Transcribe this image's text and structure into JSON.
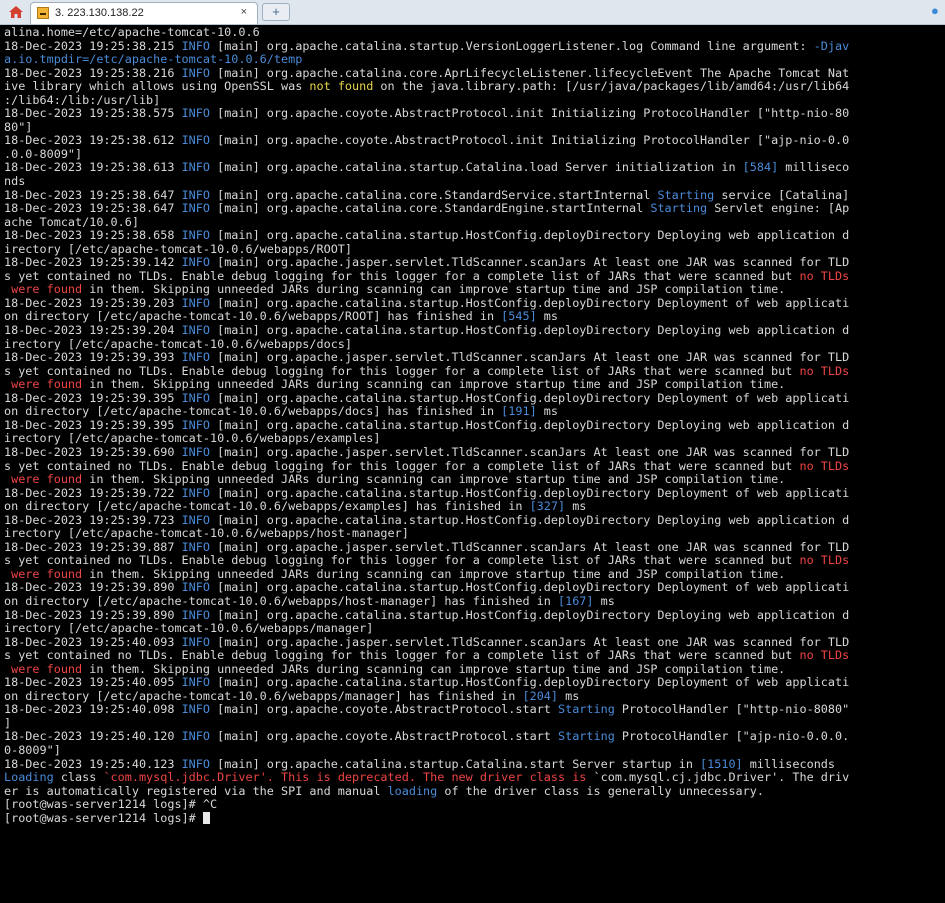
{
  "tab": {
    "title": "3. 223.130.138.22",
    "close": "×",
    "new_tab": "+"
  },
  "icons": {
    "home": "home-icon",
    "tab": "terminal-icon",
    "corner": "info-icon"
  },
  "colors": {
    "info": "#4a8bd8",
    "error": "#ef4444",
    "warning": "#e6d34a"
  },
  "terminal_lines": [
    [
      {
        "t": "alina.home=/etc/apache-tomcat-10.0.6"
      }
    ],
    [
      {
        "t": "18-Dec-2023 19:25:38.215 "
      },
      {
        "t": "INFO",
        "c": "info"
      },
      {
        "t": " [main] org.apache.catalina.startup.VersionLoggerListener.log Command line argument: "
      },
      {
        "t": "-Djav",
        "c": "info"
      }
    ],
    [
      {
        "t": "a.io.tmpdir=/etc/apache-tomcat-10.0.6/temp",
        "c": "info"
      }
    ],
    [
      {
        "t": "18-Dec-2023 19:25:38.216 "
      },
      {
        "t": "INFO",
        "c": "info"
      },
      {
        "t": " [main] org.apache.catalina.core.AprLifecycleListener.lifecycleEvent The Apache Tomcat Nat"
      }
    ],
    [
      {
        "t": "ive library which allows using OpenSSL was "
      },
      {
        "t": "not found",
        "c": "yellow"
      },
      {
        "t": " on the java.library.path: [/usr/java/packages/lib/amd64:/usr/lib64"
      }
    ],
    [
      {
        "t": ":/lib64:/lib:/usr/lib]"
      }
    ],
    [
      {
        "t": "18-Dec-2023 19:25:38.575 "
      },
      {
        "t": "INFO",
        "c": "info"
      },
      {
        "t": " [main] org.apache.coyote.AbstractProtocol.init Initializing ProtocolHandler [\"http-nio-80"
      }
    ],
    [
      {
        "t": "80\"]"
      }
    ],
    [
      {
        "t": "18-Dec-2023 19:25:38.612 "
      },
      {
        "t": "INFO",
        "c": "info"
      },
      {
        "t": " [main] org.apache.coyote.AbstractProtocol.init Initializing ProtocolHandler [\"ajp-nio-0.0"
      }
    ],
    [
      {
        "t": ".0.0-8009\"]"
      }
    ],
    [
      {
        "t": "18-Dec-2023 19:25:38.613 "
      },
      {
        "t": "INFO",
        "c": "info"
      },
      {
        "t": " [main] org.apache.catalina.startup.Catalina.load Server initialization in "
      },
      {
        "t": "[584]",
        "c": "num"
      },
      {
        "t": " milliseco"
      }
    ],
    [
      {
        "t": "nds"
      }
    ],
    [
      {
        "t": "18-Dec-2023 19:25:38.647 "
      },
      {
        "t": "INFO",
        "c": "info"
      },
      {
        "t": " [main] org.apache.catalina.core.StandardService.startInternal "
      },
      {
        "t": "Starting",
        "c": "starting"
      },
      {
        "t": " service [Catalina]"
      }
    ],
    [
      {
        "t": "18-Dec-2023 19:25:38.647 "
      },
      {
        "t": "INFO",
        "c": "info"
      },
      {
        "t": " [main] org.apache.catalina.core.StandardEngine.startInternal "
      },
      {
        "t": "Starting",
        "c": "starting"
      },
      {
        "t": " Servlet engine: [Ap"
      }
    ],
    [
      {
        "t": "ache Tomcat/10.0.6]"
      }
    ],
    [
      {
        "t": "18-Dec-2023 19:25:38.658 "
      },
      {
        "t": "INFO",
        "c": "info"
      },
      {
        "t": " [main] org.apache.catalina.startup.HostConfig.deployDirectory Deploying web application d"
      }
    ],
    [
      {
        "t": "irectory [/etc/apache-tomcat-10.0.6/webapps/ROOT]"
      }
    ],
    [
      {
        "t": "18-Dec-2023 19:25:39.142 "
      },
      {
        "t": "INFO",
        "c": "info"
      },
      {
        "t": " [main] org.apache.jasper.servlet.TldScanner.scanJars At least one JAR was scanned for TLD"
      }
    ],
    [
      {
        "t": "s yet contained no TLDs. Enable debug logging for this logger for a complete list of JARs that were scanned but "
      },
      {
        "t": "no TLDs",
        "c": "warn"
      }
    ],
    [
      {
        "t": " were found",
        "c": "warn"
      },
      {
        "t": " in them. Skipping unneeded JARs during scanning can improve startup time and JSP compilation time."
      }
    ],
    [
      {
        "t": "18-Dec-2023 19:25:39.203 "
      },
      {
        "t": "INFO",
        "c": "info"
      },
      {
        "t": " [main] org.apache.catalina.startup.HostConfig.deployDirectory Deployment of web applicati"
      }
    ],
    [
      {
        "t": "on directory [/etc/apache-tomcat-10.0.6/webapps/ROOT] has finished in "
      },
      {
        "t": "[545]",
        "c": "num"
      },
      {
        "t": " ms"
      }
    ],
    [
      {
        "t": "18-Dec-2023 19:25:39.204 "
      },
      {
        "t": "INFO",
        "c": "info"
      },
      {
        "t": " [main] org.apache.catalina.startup.HostConfig.deployDirectory Deploying web application d"
      }
    ],
    [
      {
        "t": "irectory [/etc/apache-tomcat-10.0.6/webapps/docs]"
      }
    ],
    [
      {
        "t": "18-Dec-2023 19:25:39.393 "
      },
      {
        "t": "INFO",
        "c": "info"
      },
      {
        "t": " [main] org.apache.jasper.servlet.TldScanner.scanJars At least one JAR was scanned for TLD"
      }
    ],
    [
      {
        "t": "s yet contained no TLDs. Enable debug logging for this logger for a complete list of JARs that were scanned but "
      },
      {
        "t": "no TLDs",
        "c": "warn"
      }
    ],
    [
      {
        "t": " were found",
        "c": "warn"
      },
      {
        "t": " in them. Skipping unneeded JARs during scanning can improve startup time and JSP compilation time."
      }
    ],
    [
      {
        "t": "18-Dec-2023 19:25:39.395 "
      },
      {
        "t": "INFO",
        "c": "info"
      },
      {
        "t": " [main] org.apache.catalina.startup.HostConfig.deployDirectory Deployment of web applicati"
      }
    ],
    [
      {
        "t": "on directory [/etc/apache-tomcat-10.0.6/webapps/docs] has finished in "
      },
      {
        "t": "[191]",
        "c": "num"
      },
      {
        "t": " ms"
      }
    ],
    [
      {
        "t": "18-Dec-2023 19:25:39.395 "
      },
      {
        "t": "INFO",
        "c": "info"
      },
      {
        "t": " [main] org.apache.catalina.startup.HostConfig.deployDirectory Deploying web application d"
      }
    ],
    [
      {
        "t": "irectory [/etc/apache-tomcat-10.0.6/webapps/examples]"
      }
    ],
    [
      {
        "t": "18-Dec-2023 19:25:39.690 "
      },
      {
        "t": "INFO",
        "c": "info"
      },
      {
        "t": " [main] org.apache.jasper.servlet.TldScanner.scanJars At least one JAR was scanned for TLD"
      }
    ],
    [
      {
        "t": "s yet contained no TLDs. Enable debug logging for this logger for a complete list of JARs that were scanned but "
      },
      {
        "t": "no TLDs",
        "c": "warn"
      }
    ],
    [
      {
        "t": " were found",
        "c": "warn"
      },
      {
        "t": " in them. Skipping unneeded JARs during scanning can improve startup time and JSP compilation time."
      }
    ],
    [
      {
        "t": "18-Dec-2023 19:25:39.722 "
      },
      {
        "t": "INFO",
        "c": "info"
      },
      {
        "t": " [main] org.apache.catalina.startup.HostConfig.deployDirectory Deployment of web applicati"
      }
    ],
    [
      {
        "t": "on directory [/etc/apache-tomcat-10.0.6/webapps/examples] has finished in "
      },
      {
        "t": "[327]",
        "c": "num"
      },
      {
        "t": " ms"
      }
    ],
    [
      {
        "t": "18-Dec-2023 19:25:39.723 "
      },
      {
        "t": "INFO",
        "c": "info"
      },
      {
        "t": " [main] org.apache.catalina.startup.HostConfig.deployDirectory Deploying web application d"
      }
    ],
    [
      {
        "t": "irectory [/etc/apache-tomcat-10.0.6/webapps/host-manager]"
      }
    ],
    [
      {
        "t": "18-Dec-2023 19:25:39.887 "
      },
      {
        "t": "INFO",
        "c": "info"
      },
      {
        "t": " [main] org.apache.jasper.servlet.TldScanner.scanJars At least one JAR was scanned for TLD"
      }
    ],
    [
      {
        "t": "s yet contained no TLDs. Enable debug logging for this logger for a complete list of JARs that were scanned but "
      },
      {
        "t": "no TLDs",
        "c": "warn"
      }
    ],
    [
      {
        "t": " were found",
        "c": "warn"
      },
      {
        "t": " in them. Skipping unneeded JARs during scanning can improve startup time and JSP compilation time."
      }
    ],
    [
      {
        "t": "18-Dec-2023 19:25:39.890 "
      },
      {
        "t": "INFO",
        "c": "info"
      },
      {
        "t": " [main] org.apache.catalina.startup.HostConfig.deployDirectory Deployment of web applicati"
      }
    ],
    [
      {
        "t": "on directory [/etc/apache-tomcat-10.0.6/webapps/host-manager] has finished in "
      },
      {
        "t": "[167]",
        "c": "num"
      },
      {
        "t": " ms"
      }
    ],
    [
      {
        "t": "18-Dec-2023 19:25:39.890 "
      },
      {
        "t": "INFO",
        "c": "info"
      },
      {
        "t": " [main] org.apache.catalina.startup.HostConfig.deployDirectory Deploying web application d"
      }
    ],
    [
      {
        "t": "irectory [/etc/apache-tomcat-10.0.6/webapps/manager]"
      }
    ],
    [
      {
        "t": "18-Dec-2023 19:25:40.093 "
      },
      {
        "t": "INFO",
        "c": "info"
      },
      {
        "t": " [main] org.apache.jasper.servlet.TldScanner.scanJars At least one JAR was scanned for TLD"
      }
    ],
    [
      {
        "t": "s yet contained no TLDs. Enable debug logging for this logger for a complete list of JARs that were scanned but "
      },
      {
        "t": "no TLDs",
        "c": "warn"
      }
    ],
    [
      {
        "t": " were found",
        "c": "warn"
      },
      {
        "t": " in them. Skipping unneeded JARs during scanning can improve startup time and JSP compilation time."
      }
    ],
    [
      {
        "t": "18-Dec-2023 19:25:40.095 "
      },
      {
        "t": "INFO",
        "c": "info"
      },
      {
        "t": " [main] org.apache.catalina.startup.HostConfig.deployDirectory Deployment of web applicati"
      }
    ],
    [
      {
        "t": "on directory [/etc/apache-tomcat-10.0.6/webapps/manager] has finished in "
      },
      {
        "t": "[204]",
        "c": "num"
      },
      {
        "t": " ms"
      }
    ],
    [
      {
        "t": "18-Dec-2023 19:25:40.098 "
      },
      {
        "t": "INFO",
        "c": "info"
      },
      {
        "t": " [main] org.apache.coyote.AbstractProtocol.start "
      },
      {
        "t": "Starting",
        "c": "starting"
      },
      {
        "t": " ProtocolHandler [\"http-nio-8080\""
      }
    ],
    [
      {
        "t": "]"
      }
    ],
    [
      {
        "t": "18-Dec-2023 19:25:40.120 "
      },
      {
        "t": "INFO",
        "c": "info"
      },
      {
        "t": " [main] org.apache.coyote.AbstractProtocol.start "
      },
      {
        "t": "Starting",
        "c": "starting"
      },
      {
        "t": " ProtocolHandler [\"ajp-nio-0.0.0."
      }
    ],
    [
      {
        "t": "0-8009\"]"
      }
    ],
    [
      {
        "t": "18-Dec-2023 19:25:40.123 "
      },
      {
        "t": "INFO",
        "c": "info"
      },
      {
        "t": " [main] org.apache.catalina.startup.Catalina.start Server startup in "
      },
      {
        "t": "[1510]",
        "c": "num"
      },
      {
        "t": " milliseconds"
      }
    ],
    [
      {
        "t": "Loading",
        "c": "info"
      },
      {
        "t": " class "
      },
      {
        "t": "`com.mysql.jdbc.Driver'. This is deprecated. The new driver class is",
        "c": "warn"
      },
      {
        "t": " `com.mysql.cj.jdbc.Driver'. The driv"
      }
    ],
    [
      {
        "t": "er is automatically registered via the SPI and manual "
      },
      {
        "t": "loading",
        "c": "info"
      },
      {
        "t": " of the driver class is generally unnecessary."
      }
    ],
    [
      {
        "t": "[root@was-server1214 logs]# ^C"
      }
    ],
    [
      {
        "t": "[root@was-server1214 logs]# "
      }
    ]
  ]
}
